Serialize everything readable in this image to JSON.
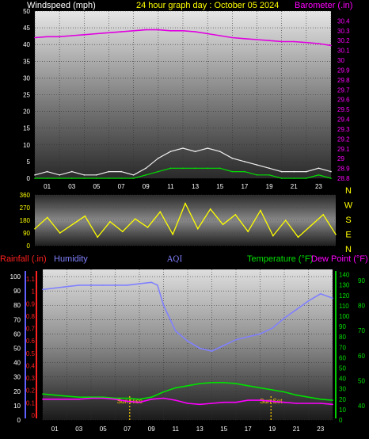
{
  "chart_data": [
    {
      "type": "line",
      "panel": "wind-barometer",
      "title": "24 hour graph day : October 05 2024",
      "ylabel_left": "Windspeed (mph)",
      "ylabel_right": "Barometer (.in)",
      "ylim_left": [
        0,
        50
      ],
      "yticks_left": [
        "0",
        "5",
        "10",
        "15",
        "20",
        "25",
        "30",
        "35",
        "40",
        "45",
        "50"
      ],
      "ylim_right": [
        28.8,
        30.5
      ],
      "yticks_right": [
        "28.8",
        "28.9",
        "29",
        "29.1",
        "29.2",
        "29.3",
        "29.4",
        "29.5",
        "29.6",
        "29.7",
        "29.8",
        "29.9",
        "30",
        "30.1",
        "30.2",
        "30.3",
        "30.4"
      ],
      "xlim": [
        0,
        24
      ],
      "xticks": [
        "01",
        "03",
        "05",
        "07",
        "09",
        "11",
        "13",
        "15",
        "17",
        "19",
        "21",
        "23"
      ],
      "grid": true,
      "colors": {
        "title": "#ffff00",
        "left_label": "#ffffff",
        "right_label": "#ff00ff",
        "barometer": "#e000e0",
        "gust": "#f0f0f0",
        "wind": "#00e000",
        "right_ticks": "#ff00ff"
      },
      "series": [
        {
          "name": "Barometer",
          "axis": "right",
          "x": [
            0,
            1,
            2,
            3,
            4,
            5,
            6,
            7,
            8,
            9,
            10,
            11,
            12,
            13,
            14,
            15,
            16,
            17,
            18,
            19,
            20,
            21,
            22,
            23,
            24
          ],
          "values": [
            30.23,
            30.24,
            30.24,
            30.25,
            30.26,
            30.27,
            30.28,
            30.29,
            30.3,
            30.31,
            30.31,
            30.3,
            30.3,
            30.29,
            30.27,
            30.25,
            30.23,
            30.22,
            30.21,
            30.2,
            30.19,
            30.19,
            30.18,
            30.17,
            30.15
          ]
        },
        {
          "name": "Wind gust",
          "axis": "left",
          "x": [
            0,
            1,
            2,
            3,
            4,
            5,
            6,
            7,
            8,
            9,
            10,
            11,
            12,
            13,
            14,
            15,
            16,
            17,
            18,
            19,
            20,
            21,
            22,
            23,
            24
          ],
          "values": [
            1,
            2,
            1,
            2,
            1,
            1,
            2,
            2,
            1,
            3,
            6,
            8,
            9,
            8,
            9,
            8,
            6,
            5,
            4,
            3,
            2,
            2,
            2,
            3,
            2
          ]
        },
        {
          "name": "Wind speed",
          "axis": "left",
          "x": [
            0,
            1,
            2,
            3,
            4,
            5,
            6,
            7,
            8,
            9,
            10,
            11,
            12,
            13,
            14,
            15,
            16,
            17,
            18,
            19,
            20,
            21,
            22,
            23,
            24
          ],
          "values": [
            0,
            0,
            0,
            0,
            0,
            0,
            0,
            0,
            0,
            1,
            2,
            3,
            3,
            3,
            3,
            3,
            2,
            2,
            1,
            1,
            0,
            0,
            0,
            1,
            0
          ]
        }
      ]
    },
    {
      "type": "line",
      "panel": "wind-direction",
      "ylim": [
        0,
        360
      ],
      "yticks": [
        "0",
        "90",
        "180",
        "270",
        "360"
      ],
      "xlim": [
        0,
        24
      ],
      "compass": [
        "N",
        "W",
        "S",
        "E",
        "N"
      ],
      "grid": true,
      "colors": {
        "line": "#ffff00",
        "ticks": "#ffff00",
        "compass": "#ffff00"
      },
      "series": [
        {
          "name": "Wind direction",
          "x": [
            0,
            1,
            2,
            3,
            4,
            5,
            6,
            7,
            8,
            9,
            10,
            11,
            12,
            13,
            14,
            15,
            16,
            17,
            18,
            19,
            20,
            21,
            22,
            23,
            24
          ],
          "values": [
            120,
            200,
            90,
            150,
            210,
            60,
            170,
            100,
            190,
            130,
            240,
            80,
            300,
            120,
            260,
            150,
            220,
            100,
            250,
            70,
            180,
            60,
            140,
            220,
            80
          ]
        }
      ]
    },
    {
      "type": "line",
      "panel": "temperature-humidity",
      "labels": {
        "rainfall": "Rainfall (.in)",
        "humidity": "Humidity",
        "aqi": "AQI",
        "temperature": "Temperature (°F)",
        "dewpoint": "Dew Point (°F)"
      },
      "humidity_yticks": [
        "0",
        "10",
        "20",
        "30",
        "40",
        "50",
        "60",
        "70",
        "80",
        "90",
        "100"
      ],
      "rainfall_yticks": [
        "0",
        "0.1",
        "0.2",
        "0.3",
        "0.4",
        "0.5",
        "0.6",
        "0.7",
        "0.8",
        "0.9",
        "1",
        "1.1"
      ],
      "temp_yticks": [
        "0",
        "10",
        "20",
        "30",
        "40",
        "50",
        "60",
        "70",
        "80",
        "90",
        "100",
        "110",
        "120",
        "130",
        "140"
      ],
      "aqi_yticks": [
        "40",
        "50",
        "60",
        "70",
        "80",
        "90"
      ],
      "ylim_humidity": [
        0,
        105
      ],
      "ylim_temp": [
        0,
        145
      ],
      "xlim": [
        0,
        24
      ],
      "xticks": [
        "01",
        "03",
        "05",
        "07",
        "09",
        "11",
        "13",
        "15",
        "17",
        "19",
        "21",
        "23"
      ],
      "markers": [
        {
          "label": "Sun Rise",
          "x": 7.2
        },
        {
          "label": "Sun Set",
          "x": 18.9
        }
      ],
      "grid": true,
      "colors": {
        "rainfall": "#ff2020",
        "humidity": "#8080ff",
        "aqi": "#8080ff",
        "temperature": "#00e000",
        "dewpoint": "#ff00ff",
        "temp_ticks": "#00e000",
        "markers": "#ffcc00",
        "aqi_ticks": "#00e000"
      },
      "series": [
        {
          "name": "Humidity",
          "axis": "humidity",
          "x": [
            0,
            1,
            2,
            3,
            4,
            5,
            6,
            7,
            8,
            9,
            9.5,
            10,
            11,
            12,
            13,
            14,
            15,
            16,
            17,
            18,
            19,
            20,
            21,
            22,
            23,
            24
          ],
          "values": [
            91,
            92,
            93,
            94,
            94,
            94,
            94,
            94,
            95,
            96,
            94,
            80,
            62,
            55,
            50,
            48,
            52,
            56,
            58,
            60,
            64,
            71,
            77,
            83,
            88,
            85
          ]
        },
        {
          "name": "Temperature",
          "axis": "temp",
          "x": [
            0,
            1,
            2,
            3,
            4,
            5,
            6,
            7,
            8,
            9,
            10,
            11,
            12,
            13,
            14,
            15,
            16,
            17,
            18,
            19,
            20,
            21,
            22,
            23,
            24
          ],
          "values": [
            25,
            24,
            23,
            22,
            22,
            22,
            21,
            21,
            20,
            22,
            27,
            31,
            33,
            35,
            36,
            36,
            35,
            33,
            31,
            29,
            27,
            24,
            22,
            20,
            19
          ]
        },
        {
          "name": "Dew Point",
          "axis": "temp",
          "x": [
            0,
            1,
            2,
            3,
            4,
            5,
            6,
            7,
            8,
            9,
            10,
            11,
            12,
            13,
            14,
            15,
            16,
            17,
            18,
            19,
            20,
            21,
            22,
            23,
            24
          ],
          "values": [
            20,
            20,
            20,
            20,
            21,
            21,
            20,
            18,
            17,
            20,
            21,
            19,
            16,
            15,
            16,
            17,
            17,
            19,
            19,
            18,
            17,
            16,
            16,
            16,
            15
          ]
        }
      ]
    }
  ]
}
